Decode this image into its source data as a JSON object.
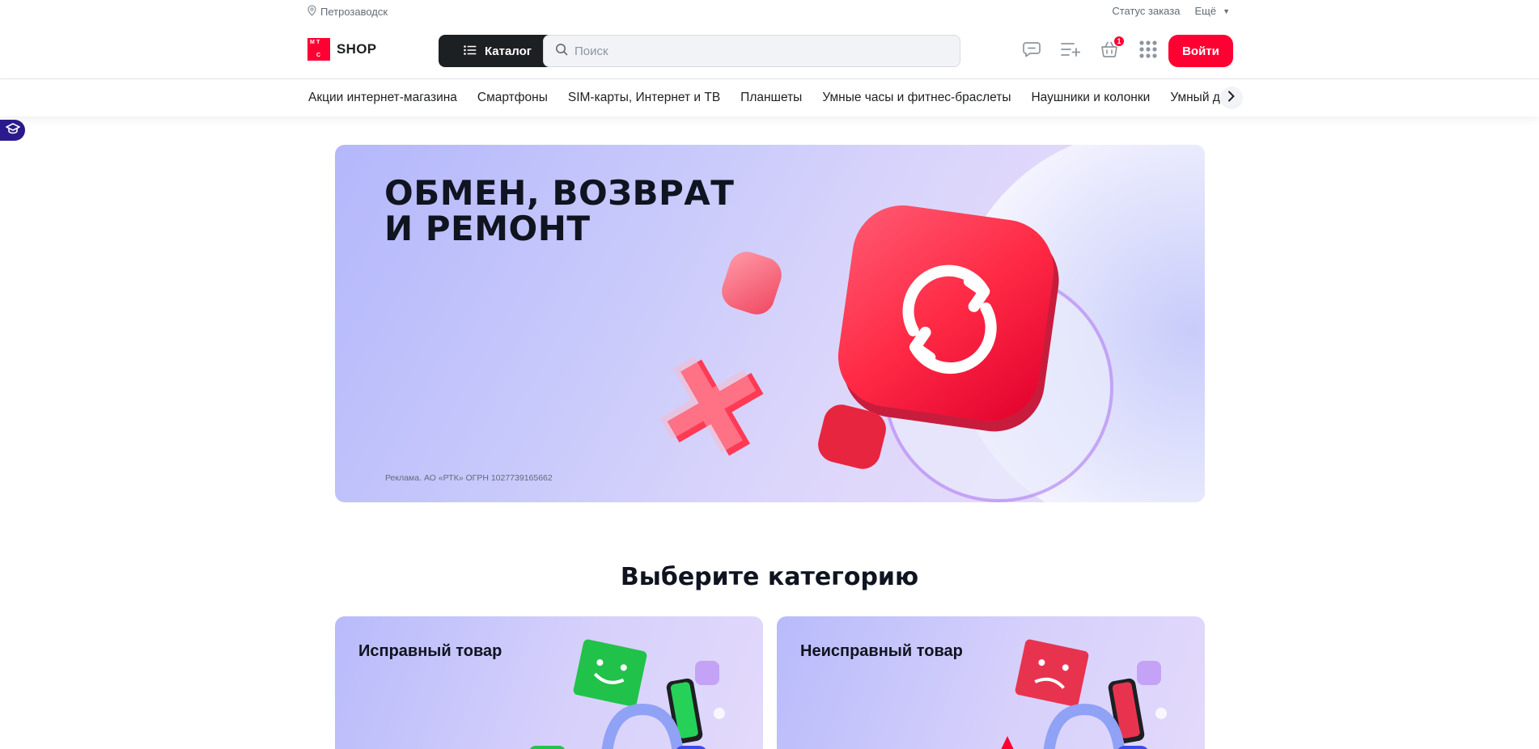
{
  "topbar": {
    "city": "Петрозаводск",
    "order_status": "Статус заказа",
    "more": "Ещё"
  },
  "header": {
    "logo_letters": [
      "М",
      "Т",
      "С"
    ],
    "logo_text": "SHOP",
    "catalog_label": "Каталог",
    "search_placeholder": "Поиск",
    "cart_count": "1",
    "login_label": "Войти"
  },
  "nav": {
    "items": [
      "Акции интернет-магазина",
      "Смартфоны",
      "SIM-карты, Интернет и ТВ",
      "Планшеты",
      "Умные часы и фитнес-браслеты",
      "Наушники и колонки",
      "Умный дом"
    ]
  },
  "banner": {
    "title": "ОБМЕН, ВОЗВРАТ\nИ РЕМОНТ",
    "legal": "Реклама. АО «РТК» ОГРН 1027739165662"
  },
  "section": {
    "title": "Выберите категорию",
    "cards": [
      {
        "title": "Исправный товар"
      },
      {
        "title": "Неисправный товар"
      }
    ]
  },
  "colors": {
    "brand_red": "#ff0032",
    "dark": "#1d2023",
    "banner_bg": "#c9cafb"
  }
}
